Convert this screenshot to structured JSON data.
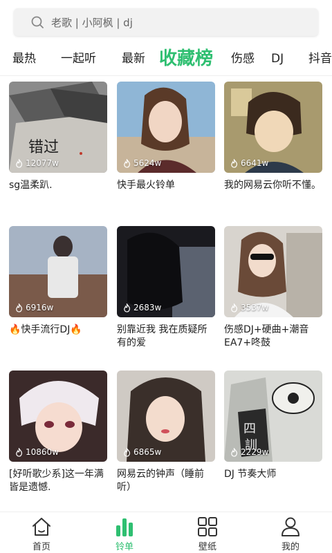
{
  "search": {
    "placeholder": "老歌 | 小阿枫 | dj"
  },
  "tabs": [
    {
      "label": "最热"
    },
    {
      "label": "一起听"
    },
    {
      "label": "最新"
    },
    {
      "label": "收藏榜"
    },
    {
      "label": "伤感"
    },
    {
      "label": "DJ"
    },
    {
      "label": "抖音"
    }
  ],
  "active_tab": "收藏榜",
  "playlists": [
    {
      "title": "sg温柔趴.",
      "plays": "12077w",
      "thumb_desc": "envelopes with handwritten 错过"
    },
    {
      "title": "快手最火铃单",
      "plays": "5624w",
      "thumb_desc": "girl portrait"
    },
    {
      "title": "我的网易云你听不懂。",
      "plays": "6641w",
      "thumb_desc": "anime boy"
    },
    {
      "title": "🔥快手流行DJ🔥",
      "plays": "6916w",
      "thumb_desc": "boy on rooftop"
    },
    {
      "title": "别靠近我 我在质疑所有的爱",
      "plays": "2683w",
      "thumb_desc": "dark silhouette"
    },
    {
      "title": "伤感DJ+硬曲+潮音EA7+咚鼓",
      "plays": "3537w",
      "thumb_desc": "girl with sunglasses"
    },
    {
      "title": "[好听歌少系]这一年满皆是遗憾.",
      "plays": "10860w",
      "thumb_desc": "anime white hair"
    },
    {
      "title": "网易云的钟声（睡前听）",
      "plays": "6865w",
      "thumb_desc": "girl selfie"
    },
    {
      "title": "DJ 节奏大师",
      "plays": "2229w",
      "thumb_desc": "manga hand"
    }
  ],
  "bottom_nav": [
    {
      "label": "首页",
      "icon": "home-icon"
    },
    {
      "label": "铃单",
      "icon": "bars-icon",
      "active": true
    },
    {
      "label": "壁纸",
      "icon": "grid-icon"
    },
    {
      "label": "我的",
      "icon": "person-icon"
    }
  ],
  "colors": {
    "accent": "#2fbf71",
    "text": "#222222",
    "search_bg": "#f2f2f2"
  }
}
